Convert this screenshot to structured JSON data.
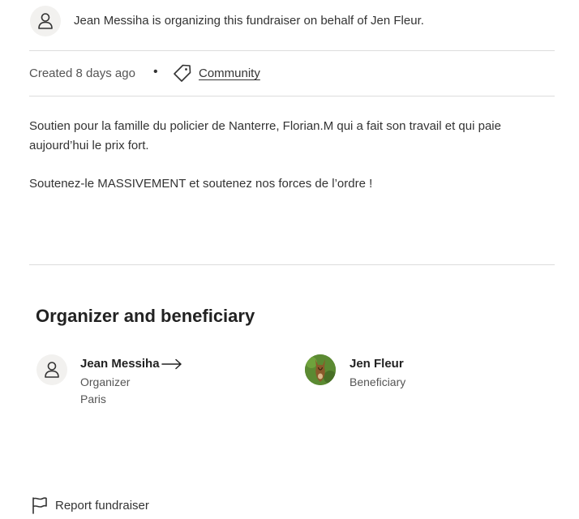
{
  "header": {
    "organizer_notice": "Jean Messiha is organizing this fundraiser on behalf of Jen Fleur."
  },
  "meta": {
    "created": "Created 8 days ago",
    "separator": "•",
    "category": "Community"
  },
  "description": {
    "paragraph1": "Soutien pour la famille du policier de Nanterre, Florian.M qui a fait son travail et qui paie aujourd’hui le prix fort.",
    "paragraph2": "Soutenez-le MASSIVEMENT et soutenez nos forces de l’ordre !"
  },
  "organizer_section": {
    "title": "Organizer and beneficiary",
    "organizer": {
      "name": "Jean Messiha",
      "role": "Organizer",
      "location": "Paris"
    },
    "beneficiary": {
      "name": "Jen Fleur",
      "role": "Beneficiary"
    }
  },
  "footer": {
    "report_label": "Report fundraiser"
  },
  "colors": {
    "divider": "#dcdcdc",
    "avatar_bg": "#f2f1ef",
    "text": "#333333"
  }
}
